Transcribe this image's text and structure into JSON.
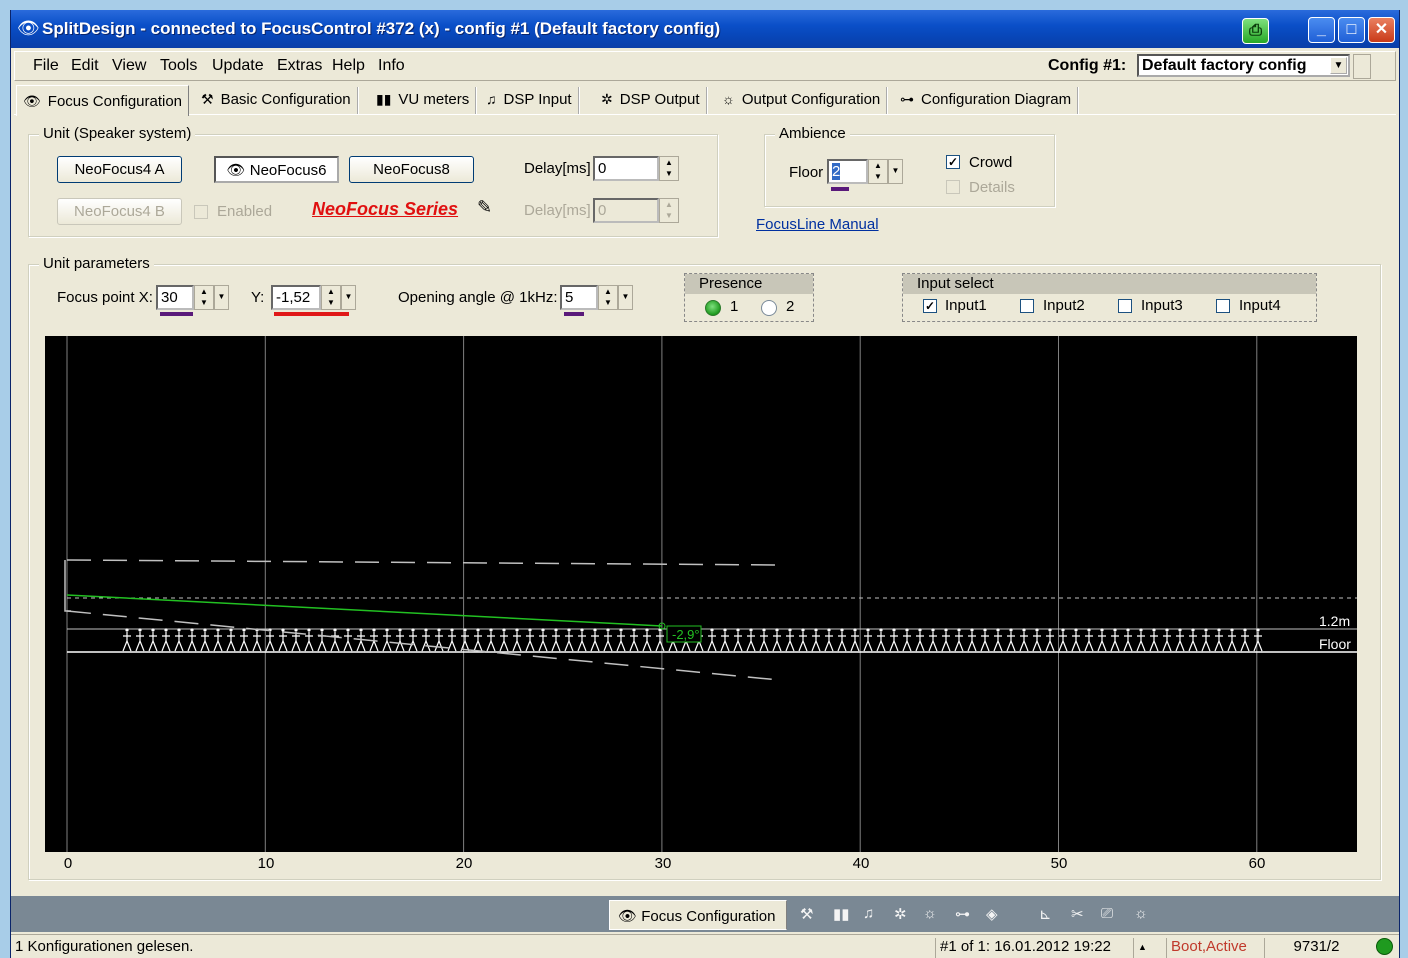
{
  "window": {
    "title": "SplitDesign - connected to FocusControl #372 (x)  -  config #1 (Default factory config)",
    "title_icon": "eye-icon",
    "controls": {
      "min": "_",
      "max": "□",
      "close": "✕"
    }
  },
  "menu": {
    "items": [
      "File",
      "Edit",
      "View",
      "Tools",
      "Update",
      "Extras",
      "Help",
      "Info"
    ],
    "config_label": "Config #1:",
    "config_value": "Default factory config"
  },
  "tabs": [
    {
      "label": "Focus Configuration",
      "icon": "eye-icon",
      "active": true
    },
    {
      "label": "Basic Configuration",
      "icon": "hammer-icon"
    },
    {
      "label": "VU meters",
      "icon": "vu-meter-icon"
    },
    {
      "label": "DSP Input",
      "icon": "dsp-input-icon"
    },
    {
      "label": "DSP Output",
      "icon": "dsp-output-icon"
    },
    {
      "label": "Output Configuration",
      "icon": "output-config-icon"
    },
    {
      "label": "Configuration Diagram",
      "icon": "diagram-icon"
    }
  ],
  "unit": {
    "group_title": "Unit (Speaker system)",
    "btn_neofocus4a": "NeoFocus4 A",
    "btn_neofocus6": "NeoFocus6",
    "btn_neofocus8": "NeoFocus8",
    "btn_neofocus4b": "NeoFocus4 B",
    "enabled_label": "Enabled",
    "series_link": "NeoFocus Series",
    "delay_label": "Delay[ms]",
    "delay_value": "0",
    "delay2_label": "Delay[ms]",
    "delay2_value": "0"
  },
  "ambience": {
    "group_title": "Ambience",
    "floor_label": "Floor",
    "floor_value": "2",
    "crowd_label": "Crowd",
    "crowd_checked": true,
    "details_label": "Details",
    "details_checked": false,
    "manual_link": "FocusLine Manual"
  },
  "params": {
    "group_title": "Unit parameters",
    "focus_x_label": "Focus point X:",
    "focus_x_value": "30",
    "y_label": "Y:",
    "y_value": "-1,52",
    "angle_label": "Opening angle @ 1kHz:",
    "angle_value": "5",
    "presence_title": "Presence",
    "presence_1": "1",
    "presence_2": "2",
    "presence_selected": "1",
    "input_select_title": "Input select",
    "inputs": [
      {
        "label": "Input1",
        "checked": true
      },
      {
        "label": "Input2",
        "checked": false
      },
      {
        "label": "Input3",
        "checked": false
      },
      {
        "label": "Input4",
        "checked": false
      }
    ]
  },
  "plot": {
    "x_ticks": [
      "0",
      "10",
      "20",
      "30",
      "40",
      "50",
      "60"
    ],
    "height_label": "1.2m",
    "floor_label": "Floor",
    "angle_label": "-2,9°",
    "focus_x": 30,
    "x_range": [
      0,
      60
    ],
    "colors": {
      "background": "#000000",
      "grid": "#808080",
      "beam": "#22c022",
      "floor": "#ffffff",
      "dashed": "#c0c0c0"
    }
  },
  "bottom_toolbar": {
    "active_label": "Focus Configuration",
    "icons": [
      "hammer-icon",
      "vu-meter-icon",
      "dsp-input-icon",
      "dsp-output-icon",
      "output-config-icon",
      "diagram-icon",
      "mask-icon",
      "graph-icon",
      "scissors-icon",
      "camera-icon",
      "sun-icon"
    ]
  },
  "status": {
    "message": "1 Konfigurationen gelesen.",
    "config_info": "#1 of 1: 16.01.2012 19:22",
    "state": "Boot,Active",
    "id": "9731/2",
    "state_color": "#c0392b",
    "led_color": "#1f9a1f"
  }
}
